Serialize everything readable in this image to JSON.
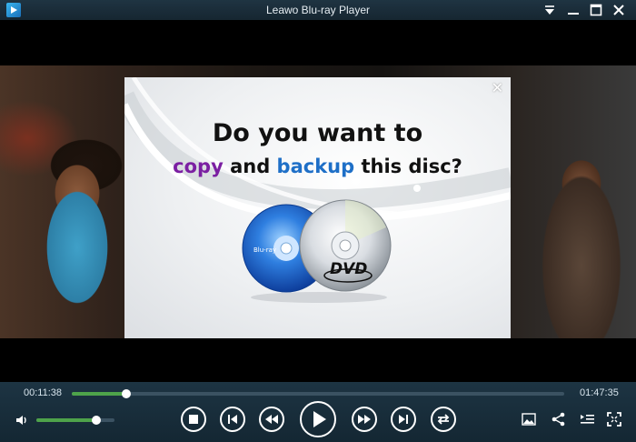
{
  "window": {
    "title": "Leawo Blu-ray Player",
    "buttons": {
      "menu_icon": "dropdown-menu-icon",
      "minimize_icon": "minimize-icon",
      "maximize_icon": "maximize-icon",
      "close_icon": "close-icon"
    }
  },
  "dialog": {
    "line1": "Do you want to",
    "line2_words": [
      "copy",
      " and ",
      "backup",
      " this disc?"
    ],
    "accent_copy": "#7b1fa2",
    "accent_backup": "#1e6fc7",
    "close_glyph": "✕",
    "disc_labels": {
      "dvd": "DVD"
    }
  },
  "player": {
    "elapsed": "00:11:38",
    "duration": "01:47:35",
    "progress_fraction": 0.11,
    "volume_fraction": 0.77,
    "progress_color": "#4ea34a"
  },
  "icons": {
    "volume": "speaker-icon",
    "stop": "stop-icon",
    "previous": "skip-previous-icon",
    "rewind": "rewind-icon",
    "play": "play-icon",
    "forward": "fast-forward-icon",
    "next": "skip-next-icon",
    "repeat": "repeat-icon",
    "snapshot": "image-icon",
    "share": "share-icon",
    "playlist": "playlist-icon",
    "fullscreen": "fullscreen-icon"
  }
}
